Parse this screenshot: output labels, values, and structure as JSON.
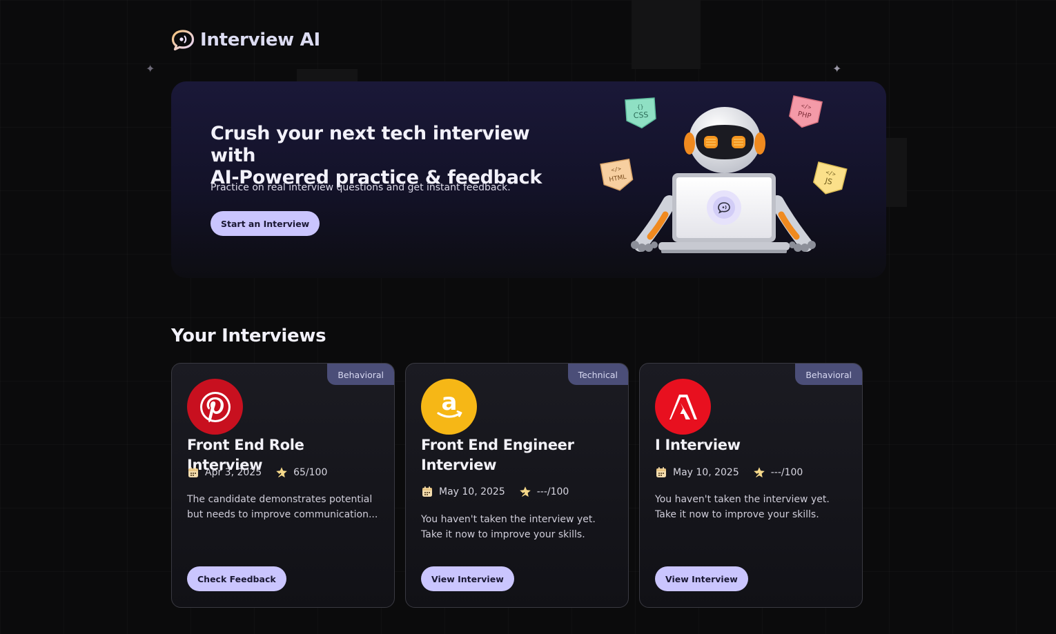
{
  "app": {
    "name": "Interview AI"
  },
  "hero": {
    "title_line1": "Crush your next tech interview with",
    "title_line2": "AI-Powered practice & feedback",
    "subtitle": "Practice on real interview questions and get instant feedback.",
    "cta_label": "Start an Interview",
    "stickers": [
      "CSS",
      "PHP",
      "HTML",
      "JS"
    ]
  },
  "interviews": {
    "section_title": "Your Interviews",
    "cards": [
      {
        "badge": "Behavioral",
        "logo": "pinterest-logo",
        "logo_color": "#c8101f",
        "title": "Front End Role Interview",
        "date": "Apr 3, 2025",
        "score": "65/100",
        "description": "The candidate demonstrates potential but needs to improve communication...",
        "button_label": "Check Feedback"
      },
      {
        "badge": "Technical",
        "logo": "amazon-logo",
        "logo_color": "#f6b716",
        "title": "Front End Engineer Interview",
        "date": "May 10, 2025",
        "score": "---/100",
        "description": "You haven't taken the interview yet. Take it now to improve your skills.",
        "button_label": "View Interview"
      },
      {
        "badge": "Behavioral",
        "logo": "adobe-logo",
        "logo_color": "#e8101f",
        "title": "I Interview",
        "date": "May 10, 2025",
        "score": "---/100",
        "description": "You haven't taken the interview yet. Take it now to improve your skills.",
        "button_label": "View Interview"
      }
    ]
  },
  "colors": {
    "accent": "#cac5fe",
    "badge_bg": "#4b4e78",
    "page_bg": "#0b0b0c"
  }
}
